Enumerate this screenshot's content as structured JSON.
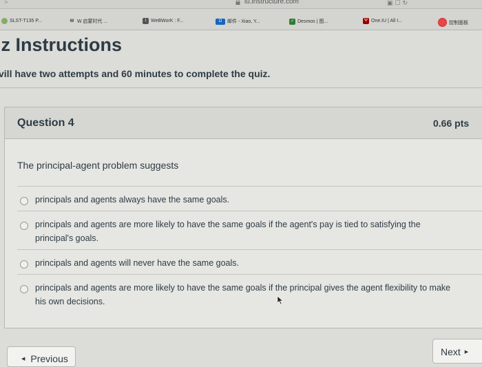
{
  "browser": {
    "url": "iu.instructure.com",
    "bookmarks": [
      {
        "label": "SLST-T135 P...",
        "icon": "globe-icon",
        "color": "#8a6"
      },
      {
        "label": "W 启蒙时代 ...",
        "icon": "wikipedia-icon",
        "color": "#666"
      },
      {
        "label": "WeBWorK : F...",
        "icon": "webwork-icon",
        "color": "#555"
      },
      {
        "label": "邮件 - Xiao, Y...",
        "icon": "outlook-icon",
        "color": "#1565c0"
      },
      {
        "label": "Desmos | 图...",
        "icon": "desmos-icon",
        "color": "#2e7d32"
      },
      {
        "label": "One.IU | All I...",
        "icon": "iu-trident-icon",
        "color": "#900"
      }
    ],
    "dashboard_label": "控制面板"
  },
  "quiz": {
    "title": "iz Instructions",
    "instructions": "vill have two attempts and 60 minutes to complete the quiz."
  },
  "question": {
    "title": "Question 4",
    "points": "0.66 pts",
    "text": "The principal-agent problem suggests",
    "answers": [
      "principals and agents always have the same goals.",
      "principals and agents are more likely to have the same goals if the agent's pay is tied to satisfying the principal's goals.",
      "principals and agents will never have the same goals.",
      "principals and agents are more likely to have the same goals if the principal gives the agent flexibility to make his own decisions."
    ]
  },
  "nav": {
    "previous_label": "Previous",
    "next_label": "Next"
  }
}
